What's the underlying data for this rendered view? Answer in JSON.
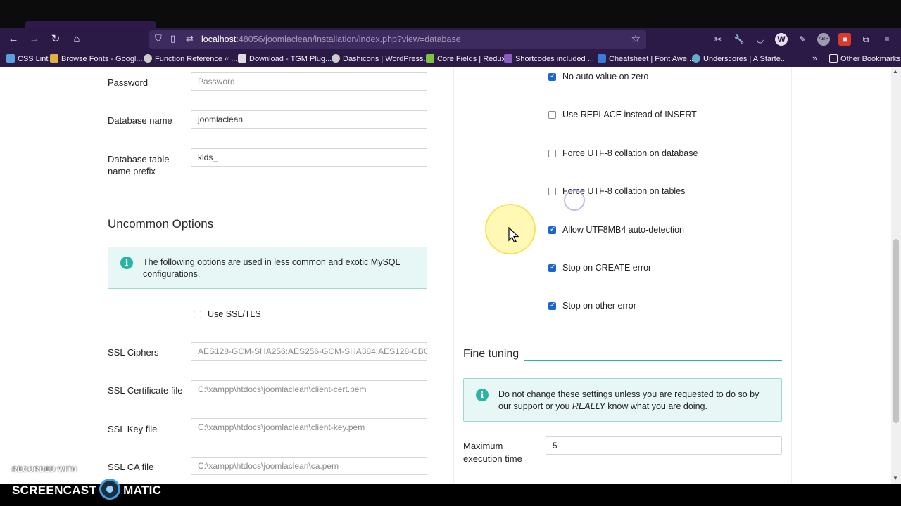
{
  "browser": {
    "url_host": "localhost",
    "url_rest": ":48056/joomlaclean/installation/index.php?view=database",
    "bookmarks": [
      {
        "label": "CSS Lint",
        "color": "#5aa0e0"
      },
      {
        "label": "Browse Fonts - Googl...",
        "color": "#e0b040"
      },
      {
        "label": "Function Reference « ...",
        "color": "#cccccc"
      },
      {
        "label": "Download - TGM Plug...",
        "color": "#dddddd"
      },
      {
        "label": "Dashicons | WordPress...",
        "color": "#cccccc"
      },
      {
        "label": "Core Fields | Redux",
        "color": "#7fc241"
      },
      {
        "label": "Shortcodes included ...",
        "color": "#8a5cc0"
      },
      {
        "label": "Cheatsheet | Font Awe...",
        "color": "#3a7ad9"
      },
      {
        "label": "Underscores | A Starte...",
        "color": "#66aacc"
      }
    ],
    "other_bookmarks": "Other Bookmarks"
  },
  "left_form": {
    "password": {
      "label": "Password",
      "placeholder": "Password"
    },
    "database_name": {
      "label": "Database name",
      "value": "joomlaclean"
    },
    "table_prefix": {
      "label_line1": "Database table",
      "label_line2": "name prefix",
      "value": "kids_"
    },
    "uncommon_title": "Uncommon Options",
    "uncommon_info_line1": "The following options are used in less common and exotic MySQL",
    "uncommon_info_line2": "configurations.",
    "use_ssl": {
      "label": "Use SSL/TLS",
      "checked": false
    },
    "ssl_ciphers": {
      "label": "SSL Ciphers",
      "value": "AES128-GCM-SHA256:AES256-GCM-SHA384:AES128-CBC"
    },
    "ssl_cert": {
      "label": "SSL Certificate file",
      "value": "C:\\xampp\\htdocs\\joomlaclean\\client-cert.pem"
    },
    "ssl_key": {
      "label": "SSL Key file",
      "value": "C:\\xampp\\htdocs\\joomlaclean\\client-key.pem"
    },
    "ssl_ca": {
      "label": "SSL CA file",
      "value": "C:\\xampp\\htdocs\\joomlaclean\\ca.pem"
    }
  },
  "right_options": {
    "checkboxes": [
      {
        "label": "No auto value on zero",
        "checked": true
      },
      {
        "label": "Use REPLACE instead of INSERT",
        "checked": false
      },
      {
        "label": "Force UTF-8 collation on database",
        "checked": false
      },
      {
        "label": "Force UTF-8 collation on tables",
        "checked": false
      },
      {
        "label": "Allow UTF8MB4 auto-detection",
        "checked": true
      },
      {
        "label": "Stop on CREATE error",
        "checked": true
      },
      {
        "label": "Stop on other error",
        "checked": true
      }
    ],
    "fine_tuning_title": "Fine tuning",
    "fine_info_line1": "Do not change these settings unless you are requested to do so by",
    "fine_info_line2a": "our support or you ",
    "fine_info_line2b": "REALLY",
    "fine_info_line2c": " know what you are doing.",
    "max_exec": {
      "label_line1": "Maximum",
      "label_line2": "execution time",
      "value": "5"
    }
  },
  "watermark": {
    "recorded": "RECORDED WITH",
    "brand_left": "SCREENCAST",
    "brand_right": "MATIC"
  },
  "colors": {
    "browser_chrome": "#2b1a45",
    "accent_teal": "#2bb3a3",
    "checkbox_blue": "#1a66c9",
    "info_bg": "#e6f7f5"
  }
}
